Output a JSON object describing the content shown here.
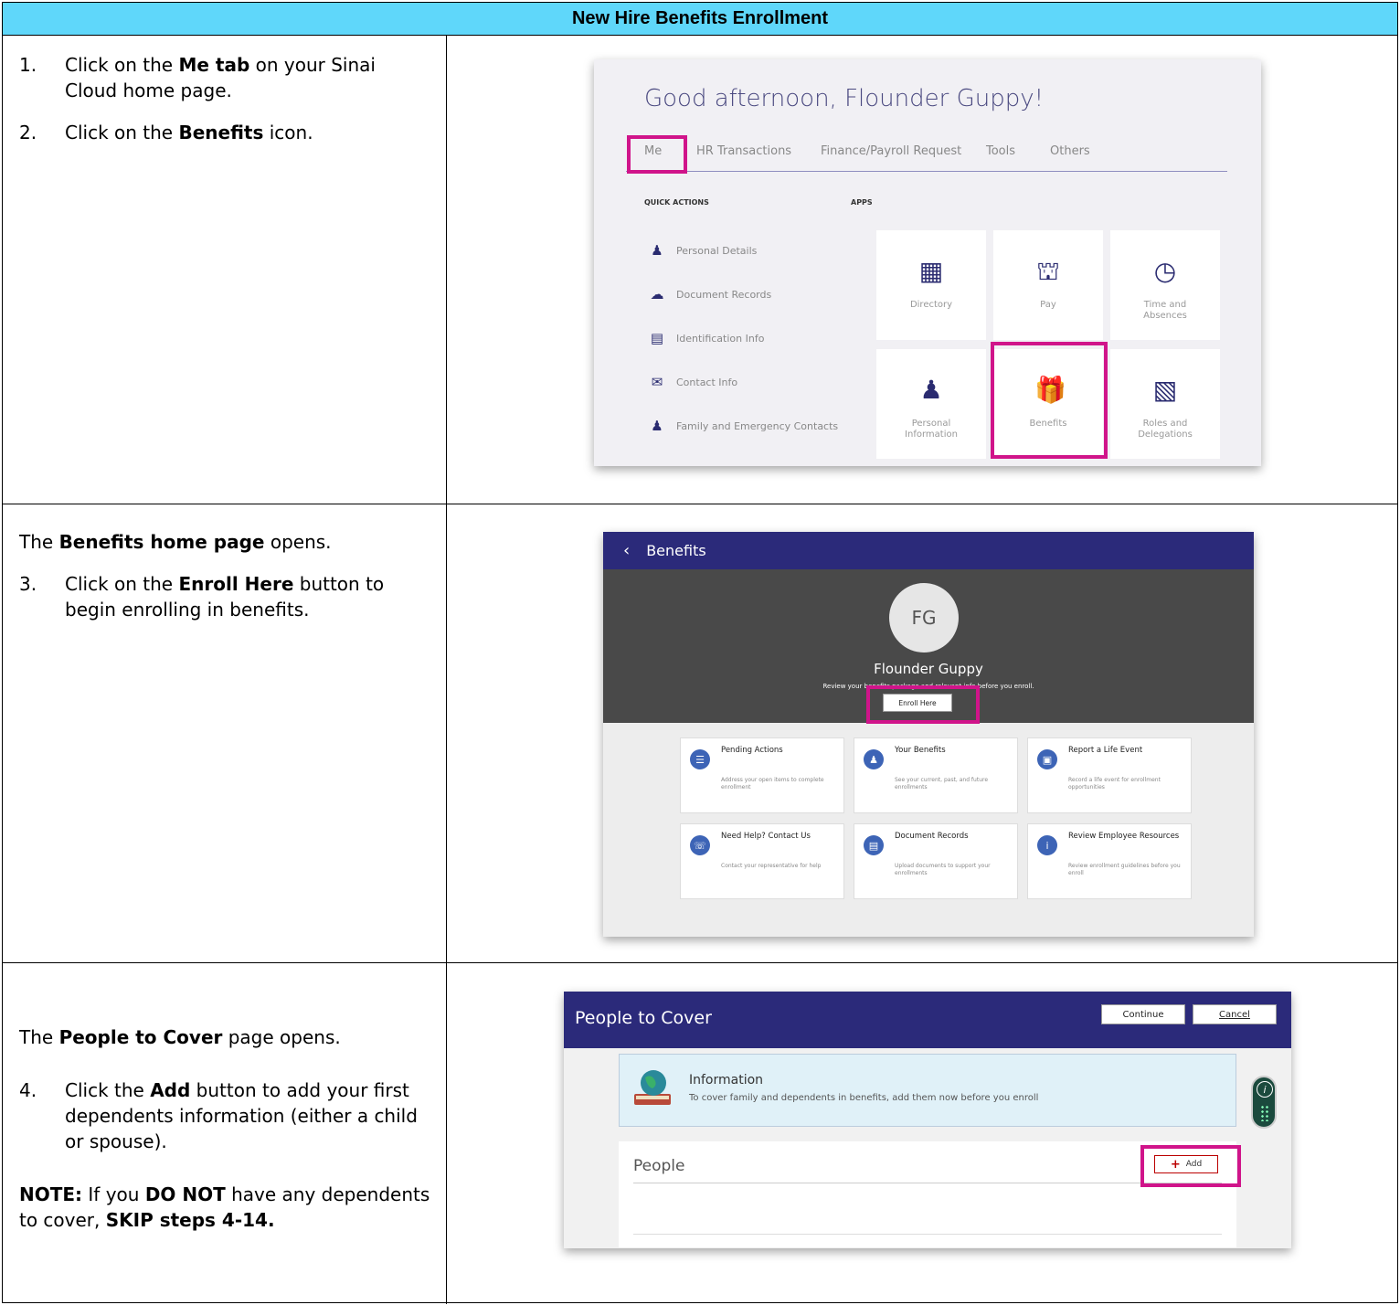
{
  "header": {
    "title": "New Hire Benefits Enrollment"
  },
  "rows": [
    {
      "steps": [
        {
          "num": "1.",
          "pre": "Click on the ",
          "bold": "Me tab",
          "post": " on your Sinai Cloud home page."
        },
        {
          "num": "2.",
          "pre": "Click on the ",
          "bold": "Benefits",
          "post": " icon."
        }
      ]
    },
    {
      "intro": {
        "bold": "Benefits home page",
        "post": " opens.",
        "pre": "The "
      },
      "steps": [
        {
          "num": "3.",
          "pre": "Click on the ",
          "bold": "Enroll Here",
          "post": " button to begin enrolling in benefits."
        }
      ]
    },
    {
      "intro": {
        "pre": "The ",
        "bold": "People to Cover",
        "post": " page opens."
      },
      "steps": [
        {
          "num": "4.",
          "pre": "Click the ",
          "bold": "Add",
          "post": " button to add your first dependents information (either a child or spouse)."
        }
      ],
      "note": {
        "label": "NOTE:",
        "pre": " If you ",
        "bold1": "DO NOT",
        "mid": " have any dependents to cover, ",
        "bold2": "SKIP steps 4-14."
      }
    }
  ],
  "ss1": {
    "greeting": "Good afternoon, Flounder Guppy!",
    "tabs": [
      "Me",
      "HR Transactions",
      "Finance/Payroll Request",
      "Tools",
      "Others"
    ],
    "quick_actions_label": "QUICK ACTIONS",
    "apps_label": "APPS",
    "quick_actions": [
      {
        "label": "Personal Details",
        "icon": "person-icon"
      },
      {
        "label": "Document Records",
        "icon": "cloud-document-icon"
      },
      {
        "label": "Identification Info",
        "icon": "id-document-icon"
      },
      {
        "label": "Contact Info",
        "icon": "envelope-icon"
      },
      {
        "label": "Family and Emergency Contacts",
        "icon": "family-icon"
      }
    ],
    "apps": [
      {
        "label": "Directory",
        "icon": "org-chart-icon"
      },
      {
        "label": "Pay",
        "icon": "bank-icon"
      },
      {
        "label": "Time and Absences",
        "icon": "clock-icon"
      },
      {
        "label": "Personal Information",
        "icon": "person-icon"
      },
      {
        "label": "Benefits",
        "icon": "gift-icon"
      },
      {
        "label": "Roles and Delegations",
        "icon": "badge-icon"
      }
    ]
  },
  "ss2": {
    "title": "Benefits",
    "initials": "FG",
    "name": "Flounder Guppy",
    "subtitle": "Review your benefits package and relevant info before you enroll.",
    "enroll_button": "Enroll Here",
    "cards": [
      {
        "title": "Pending Actions",
        "desc": "Address your open items to complete enrollment"
      },
      {
        "title": "Your Benefits",
        "desc": "See your current, past, and future enrollments"
      },
      {
        "title": "Report a Life Event",
        "desc": "Record a life event for enrollment opportunities"
      },
      {
        "title": "Need Help? Contact Us",
        "desc": "Contact your representative for help"
      },
      {
        "title": "Document Records",
        "desc": "Upload documents to support your enrollments"
      },
      {
        "title": "Review Employee Resources",
        "desc": "Review enrollment guidelines before you enroll"
      }
    ]
  },
  "ss3": {
    "title": "People to Cover",
    "continue_button": "Continue",
    "cancel_button": "Cancel",
    "info_title": "Information",
    "info_text": "To cover family and dependents in benefits, add them now before you enroll",
    "people_title": "People",
    "add_button": "Add"
  },
  "colors": {
    "header_bg": "#5fd7fa",
    "highlight": "#d0148a",
    "brand_navy": "#2b2a7a"
  }
}
